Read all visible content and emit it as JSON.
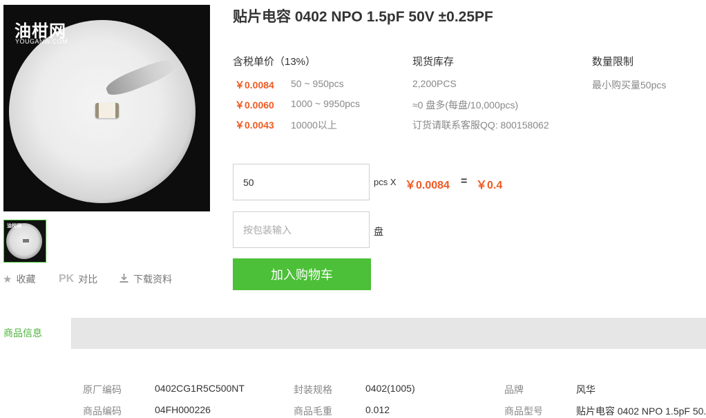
{
  "image": {
    "logo_cn": "油柑网",
    "logo_en": "YOUGANW.COM",
    "thumb_logo": "油柑网"
  },
  "actions": {
    "favorite": {
      "icon": "star-icon",
      "label": "收藏"
    },
    "compare": {
      "icon_text": "PK",
      "label": "对比"
    },
    "download": {
      "icon": "download-icon",
      "label": "下载资料"
    }
  },
  "product": {
    "title": "贴片电容 0402 NPO 1.5pF 50V ±0.25PF"
  },
  "pricing": {
    "header": "含税单价（13%）",
    "tiers": [
      {
        "price": "￥0.0084",
        "range": "50 ~ 950pcs"
      },
      {
        "price": "￥0.0060",
        "range": "1000 ~ 9950pcs"
      },
      {
        "price": "￥0.0043",
        "range": "10000以上"
      }
    ]
  },
  "stock": {
    "header": "现货库存",
    "lines": [
      "2,200PCS",
      "≈0 盘多(每盘/10,000pcs)",
      "订货请联系客服QQ: 800158062"
    ]
  },
  "limit": {
    "header": "数量限制",
    "text": "最小购买量50pcs"
  },
  "order": {
    "qty_value": "50",
    "qty_unit": "pcs X",
    "unit_price": "￥0.0084",
    "equals": "=",
    "total": "￥0.4",
    "pkg_placeholder": "按包装输入",
    "pkg_unit": "盘",
    "cart_label": "加入购物车"
  },
  "tabs": {
    "active": "商品信息"
  },
  "specs": {
    "row1": [
      {
        "label": "原厂编码",
        "value": "0402CG1R5C500NT"
      },
      {
        "label": "封装规格",
        "value": "0402(1005)"
      },
      {
        "label": "品牌",
        "value": "风华"
      }
    ],
    "row2": [
      {
        "label": "商品编码",
        "value": "04FH000226"
      },
      {
        "label": "商品毛重",
        "value": "0.012"
      },
      {
        "label": "商品型号",
        "value": "贴片电容 0402 NPO 1.5pF 50..."
      }
    ]
  },
  "colors": {
    "accent_green": "#4cc038",
    "price_orange": "#f15a22"
  }
}
